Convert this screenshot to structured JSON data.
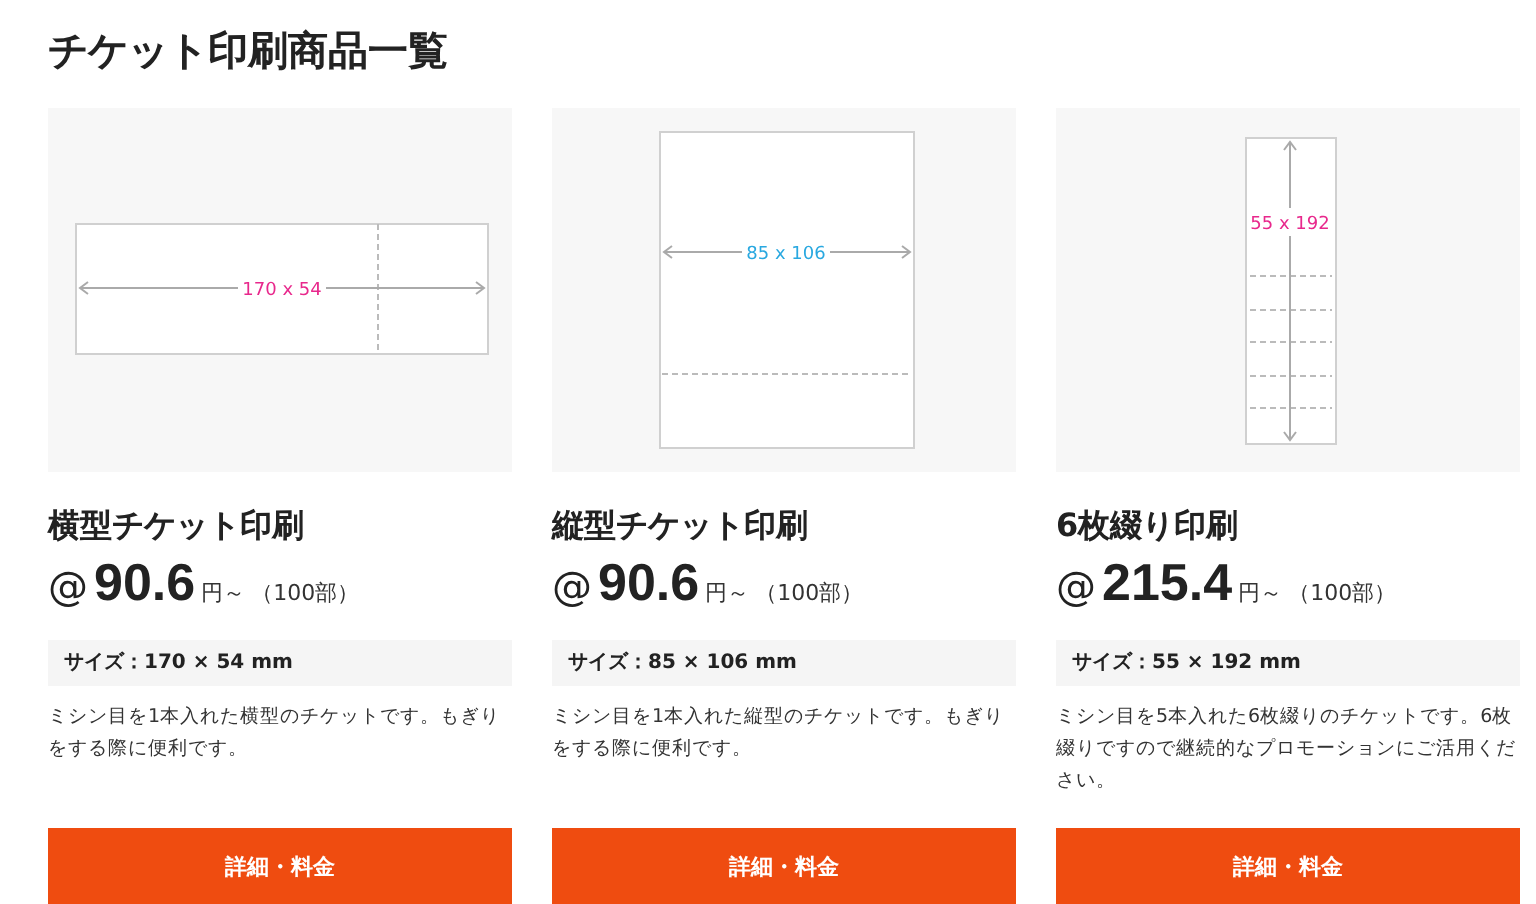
{
  "heading": "チケット印刷商品一覧",
  "products": [
    {
      "diagram": {
        "kind": "horizontal",
        "dimension": "170 x 54",
        "color": "#e8288c"
      },
      "name": "横型チケット印刷",
      "price": {
        "prefix": "@",
        "amount": "90.6",
        "unit": "円～",
        "note": "（100部）"
      },
      "size": "サイズ：170 × 54 mm",
      "description": "ミシン目を1本入れた横型のチケットです。もぎりをする際に便利です。",
      "button": "詳細・料金"
    },
    {
      "diagram": {
        "kind": "vertical",
        "dimension": "85 x 106",
        "color": "#29a8e0"
      },
      "name": "縦型チケット印刷",
      "price": {
        "prefix": "@",
        "amount": "90.6",
        "unit": "円～",
        "note": "（100部）"
      },
      "size": "サイズ：85 × 106 mm",
      "description": "ミシン目を1本入れた縦型のチケットです。もぎりをする際に便利です。",
      "button": "詳細・料金"
    },
    {
      "diagram": {
        "kind": "strip",
        "dimension": "55 x 192",
        "color": "#e8288c"
      },
      "name": "6枚綴り印刷",
      "price": {
        "prefix": "@",
        "amount": "215.4",
        "unit": "円～",
        "note": "（100部）"
      },
      "size": "サイズ：55 × 192 mm",
      "description": "ミシン目を5本入れた6枚綴りのチケットです。6枚綴りですので継続的なプロモーションにご活用ください。",
      "button": "詳細・料金"
    }
  ]
}
